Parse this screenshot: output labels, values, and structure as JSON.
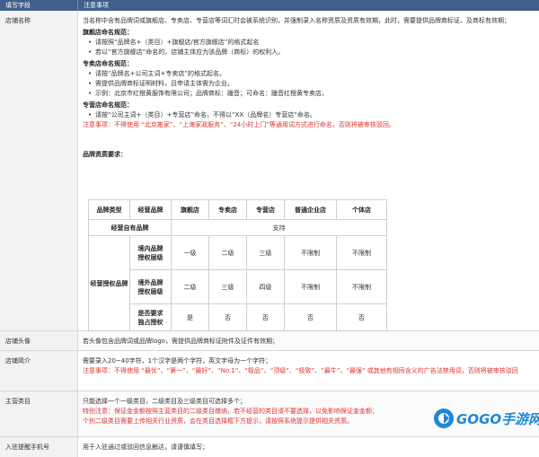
{
  "header": {
    "col1": "填写字段",
    "col2": "注意事项"
  },
  "store_name": {
    "label": "店铺名称",
    "intro": "当名称中含有品牌词或旗舰店、专卖店、专营店等词汇时会被系统识别，并强制录入名称资质及资质有效期，此时，需要提供品牌商标证、及商标有效期；",
    "flagship_title": "旗舰店命名规范：",
    "flagship_items": [
      "请按照“品牌名+（类目）+旗舰店/官方旗舰店”的格式起名",
      "若以“官方旗舰店”命名的，店铺主体应为该品牌（商标）的权利人。"
    ],
    "specialty_title": "专卖店命名规范：",
    "specialty_items": [
      "请按“品牌名+公司主词+专卖店”的格式起名。",
      "需提供品牌商标证明材料，且申请主体需为企业。",
      "示例：北京市红橙黄服饰有限公司；品牌商标：躐音；可命名：躐音红橙黄专卖店。"
    ],
    "franchise_title": "专营店命名规范：",
    "franchise_items": [
      "请按“公司主词+（类目）+专营店”命名，不得以“XX（品牌名）专营店”命名。"
    ],
    "warning": "注意事项：不得使用 “北京搬家”、“上海家政服务”、“24小时上门”等通用词方式进行命名，否则将被审核驳回。",
    "qualification_title": "品牌资质要求：",
    "table": {
      "col_headers": [
        "品牌类型",
        "经营品牌",
        "旗舰店",
        "专卖店",
        "专营店",
        "普通企业店",
        "个体店"
      ],
      "own_brand": {
        "type": "经营自有品牌",
        "value": "支持"
      },
      "authorized_group": "经营授权品牌",
      "rows": [
        {
          "brand": [
            "境内品牌",
            "授权层级"
          ],
          "cells": [
            "一级",
            "二级",
            "三级",
            "不限制",
            "不限制"
          ]
        },
        {
          "brand": [
            "境外品牌",
            "授权层级"
          ],
          "cells": [
            "二级",
            "三级",
            "四级",
            "不限制",
            "不限制"
          ]
        },
        {
          "brand": [
            "是否要求",
            "独占授权"
          ],
          "cells": [
            "是",
            "否",
            "否",
            "否",
            "否"
          ]
        }
      ]
    }
  },
  "store_avatar": {
    "label": "店铺头像",
    "text": "若头像包含品牌词或品牌logo，需提供品牌商标证附件及证件有效期；"
  },
  "store_intro": {
    "label": "店铺简介",
    "text": "需要录入20~40字符，1个汉字是两个字符，英文字母为一个字符；",
    "warning": "注意事项：不得使用 “最优”、“第一”、“最好”、“No.1”、“极品”、“顶级”、“极致”、“最牛”、“最强” 或其他有相同含义的广告法禁用词，否则将被审核驳回"
  },
  "main_category": {
    "label": "主营类目",
    "text": "只能选择一个一级类目，二级类目及三级类目可选择多个；",
    "note1": "特别注意：保证金金额按照主营类目的二级类目缴纳，若不经营的类目请不要选择，以免影响保证金金额；",
    "note2": "个别二级类目需要上传相关行业资质，会在类目选择框下方提示，请按照系统提示提供相关资质。"
  },
  "phone": {
    "label": "入驻提醒手机号",
    "text": "用于入驻通过或驳回信息触达，请谨慎填写；"
  },
  "watermark": {
    "text": "GOGO手游网"
  }
}
